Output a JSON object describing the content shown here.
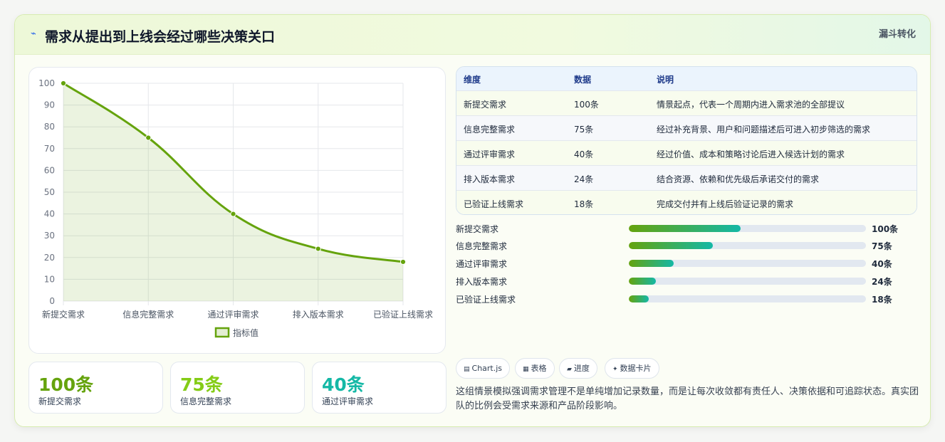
{
  "header": {
    "title": "需求从提出到上线会经过哪些决策关口",
    "tag": "漏斗转化",
    "bolt_icon": "⌁"
  },
  "chart_data": {
    "type": "line",
    "categories": [
      "新提交需求",
      "信息完整需求",
      "通过评审需求",
      "排入版本需求",
      "已验证上线需求"
    ],
    "series": [
      {
        "name": "指标值",
        "values": [
          100,
          75,
          40,
          24,
          18
        ],
        "color": "#65a30d"
      }
    ],
    "ylim": [
      0,
      100
    ],
    "yticks": [
      0,
      10,
      20,
      30,
      40,
      50,
      60,
      70,
      80,
      90,
      100
    ],
    "area_fill": true,
    "grid": true,
    "legend": "bottom"
  },
  "stats": [
    {
      "value": "100条",
      "label": "新提交需求",
      "color": "#65a30d"
    },
    {
      "value": "75条",
      "label": "信息完整需求",
      "color": "#84cc16"
    },
    {
      "value": "40条",
      "label": "通过评审需求",
      "color": "#14b8a6"
    }
  ],
  "table": {
    "headers": [
      "维度",
      "数据",
      "说明"
    ],
    "rows": [
      {
        "dim": "新提交需求",
        "data": "100条",
        "desc": "情景起点，代表一个周期内进入需求池的全部提议"
      },
      {
        "dim": "信息完整需求",
        "data": "75条",
        "desc": "经过补充背景、用户和问题描述后可进入初步筛选的需求"
      },
      {
        "dim": "通过评审需求",
        "data": "40条",
        "desc": "经过价值、成本和策略讨论后进入候选计划的需求"
      },
      {
        "dim": "排入版本需求",
        "data": "24条",
        "desc": "结合资源、依赖和优先级后承诺交付的需求"
      },
      {
        "dim": "已验证上线需求",
        "data": "18条",
        "desc": "完成交付并有上线后验证记录的需求"
      }
    ]
  },
  "progress": [
    {
      "label": "新提交需求",
      "value": "100条",
      "fraction": 0.47
    },
    {
      "label": "信息完整需求",
      "value": "75条",
      "fraction": 0.354
    },
    {
      "label": "通过评审需求",
      "value": "40条",
      "fraction": 0.189
    },
    {
      "label": "排入版本需求",
      "value": "24条",
      "fraction": 0.113
    },
    {
      "label": "已验证上线需求",
      "value": "18条",
      "fraction": 0.085
    }
  ],
  "chips": [
    {
      "icon": "▤",
      "label": "Chart.js"
    },
    {
      "icon": "▦",
      "label": "表格"
    },
    {
      "icon": "▰",
      "label": "进度"
    },
    {
      "icon": "✦",
      "label": "数据卡片"
    }
  ],
  "note": "这组情景模拟强调需求管理不是单纯增加记录数量，而是让每次收敛都有责任人、决策依据和可追踪状态。真实团队的比例会受需求来源和产品阶段影响。"
}
